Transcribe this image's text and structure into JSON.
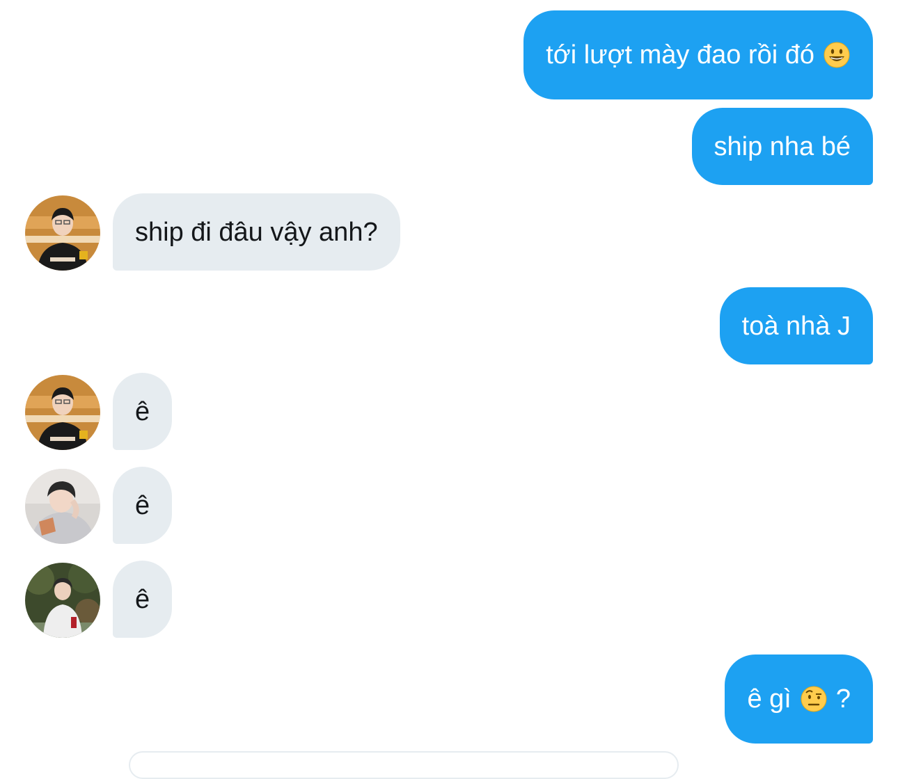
{
  "conversation": {
    "messages": [
      {
        "direction": "outgoing",
        "text": "tới lượt mày đao rồi đó",
        "emoji": "smiley-emoji"
      },
      {
        "direction": "outgoing",
        "text": "ship nha bé"
      },
      {
        "direction": "incoming",
        "text": "ship đi đâu vậy anh?",
        "avatar": "avatar-user-1"
      },
      {
        "direction": "outgoing",
        "text": "toà nhà J"
      },
      {
        "direction": "incoming",
        "text": "ê",
        "avatar": "avatar-user-1"
      },
      {
        "direction": "incoming",
        "text": "ê",
        "avatar": "avatar-user-2"
      },
      {
        "direction": "incoming",
        "text": "ê",
        "avatar": "avatar-user-3"
      },
      {
        "direction": "outgoing",
        "text_before": "ê gì",
        "emoji": "raised-eyebrow-emoji",
        "text_after": "?"
      }
    ]
  },
  "colors": {
    "outgoing_bubble": "#1da1f2",
    "incoming_bubble": "#e6ecf0",
    "outgoing_text": "#ffffff",
    "incoming_text": "#14171a"
  }
}
